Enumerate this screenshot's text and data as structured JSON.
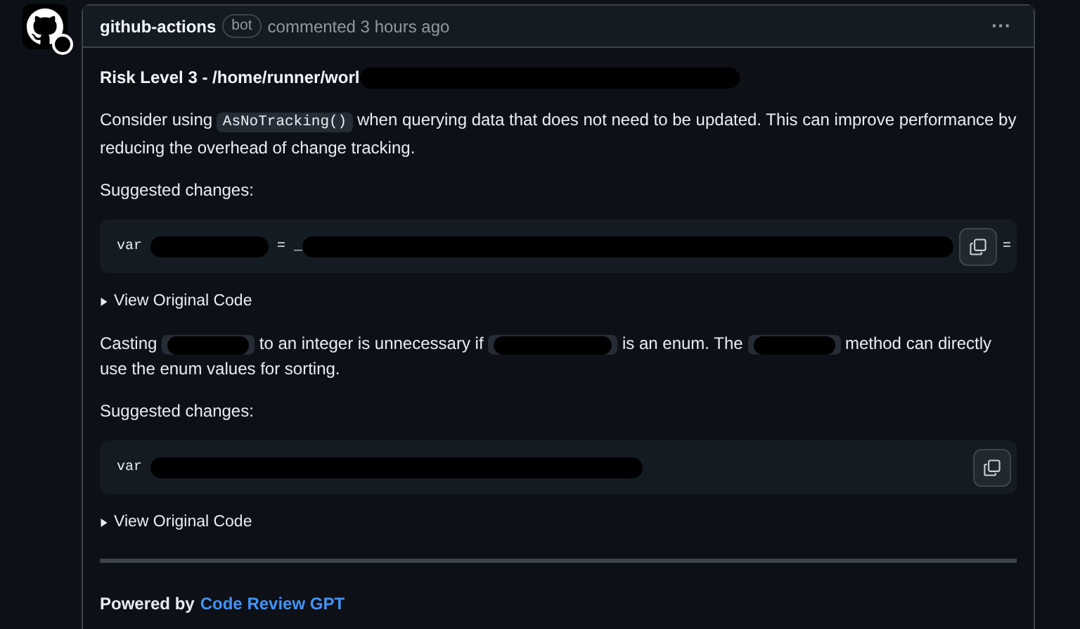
{
  "comment": {
    "author": "github-actions",
    "badge": "bot",
    "meta": "commented 3 hours ago",
    "more": "···",
    "blocks": [
      {
        "kind": "heading",
        "parts": [
          {
            "kind": "text",
            "text": "Risk Level 3 - /home/runner/worl"
          },
          {
            "kind": "redacted"
          }
        ]
      },
      {
        "kind": "paragraph",
        "parts": [
          {
            "kind": "text",
            "text": "Consider using "
          },
          {
            "kind": "code",
            "text": "AsNoTracking()"
          },
          {
            "kind": "text",
            "text": " when querying data that does not need to be updated. This can improve performance by reducing the overhead of change tracking."
          }
        ]
      },
      {
        "kind": "label",
        "text": "Suggested changes:"
      },
      {
        "kind": "codeblock",
        "parts": [
          {
            "kind": "text",
            "text": "var "
          },
          {
            "kind": "redacted"
          },
          {
            "kind": "text",
            "text": " = _"
          },
          {
            "kind": "redacted"
          }
        ],
        "tail": "="
      },
      {
        "kind": "details",
        "text": "View Original Code",
        "expanded": false
      },
      {
        "kind": "paragraph",
        "parts": [
          {
            "kind": "text",
            "text": "Casting "
          },
          {
            "kind": "redacted"
          },
          {
            "kind": "text",
            "text": " to an integer is unnecessary if "
          },
          {
            "kind": "redacted"
          },
          {
            "kind": "text",
            "text": " is an enum. The "
          },
          {
            "kind": "redacted"
          },
          {
            "kind": "text",
            "text": " method can directly use the enum values for sorting."
          }
        ]
      },
      {
        "kind": "label",
        "text": "Suggested changes:"
      },
      {
        "kind": "codeblock",
        "parts": [
          {
            "kind": "text",
            "text": "var "
          },
          {
            "kind": "redacted"
          }
        ]
      },
      {
        "kind": "details",
        "text": "View Original Code",
        "expanded": false
      },
      {
        "kind": "rule"
      }
    ],
    "footer": {
      "prefix": "Powered by",
      "link": "Code Review GPT"
    }
  }
}
